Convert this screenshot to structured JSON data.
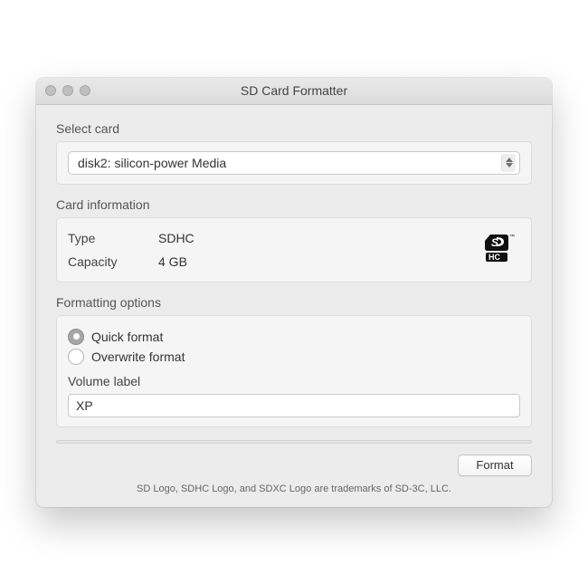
{
  "window": {
    "title": "SD Card Formatter"
  },
  "select_card": {
    "heading": "Select card",
    "selected": "disk2: silicon-power Media"
  },
  "card_info": {
    "heading": "Card information",
    "type_label": "Type",
    "type_value": "SDHC",
    "capacity_label": "Capacity",
    "capacity_value": "4 GB"
  },
  "formatting": {
    "heading": "Formatting options",
    "quick_label": "Quick format",
    "overwrite_label": "Overwrite format",
    "volume_label_heading": "Volume label",
    "volume_label_value": "XP"
  },
  "footer": {
    "format_button": "Format",
    "trademark": "SD Logo, SDHC Logo, and SDXC Logo are trademarks of SD-3C, LLC."
  }
}
